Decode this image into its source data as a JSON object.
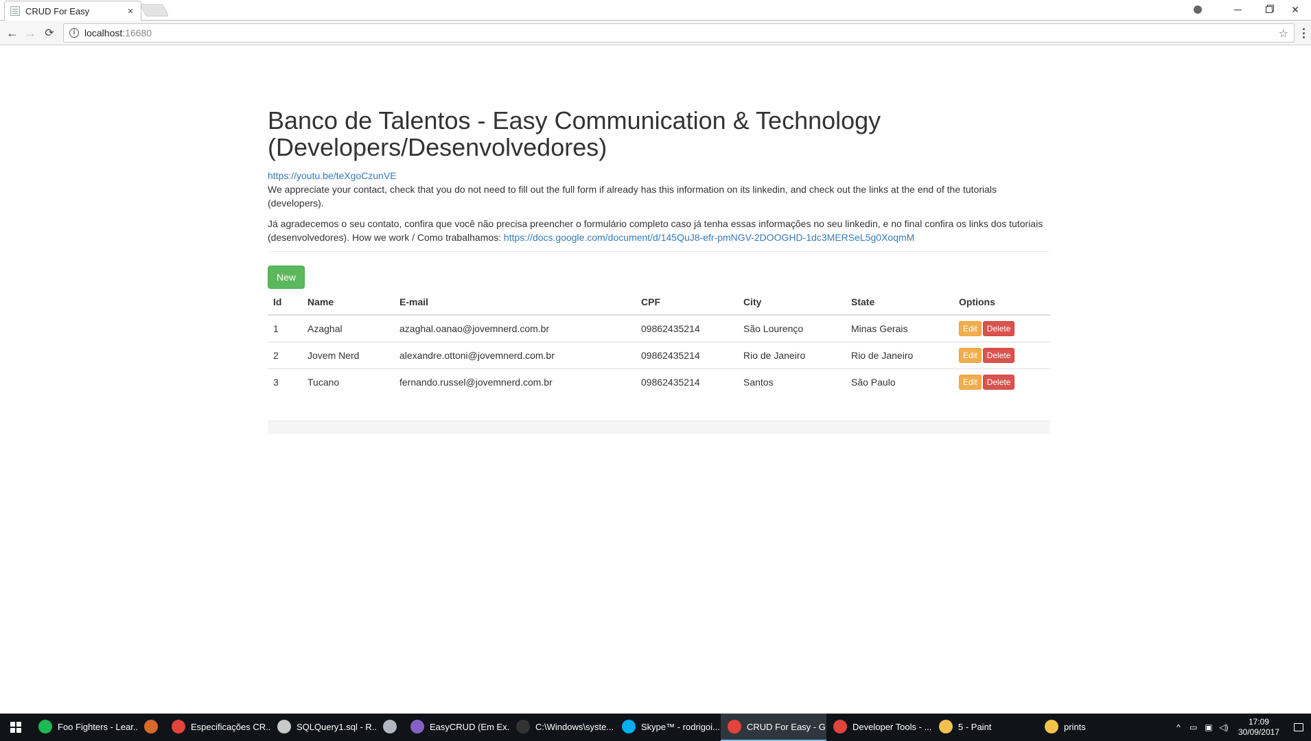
{
  "browser": {
    "tab_title": "CRUD For Easy",
    "tab_close": "×",
    "url_host": "localhost",
    "url_port": ":16680"
  },
  "page": {
    "title": "Banco de Talentos - Easy Communication & Technology (Developers/Desenvolvedores)",
    "video_link": "https://youtu.be/teXgoCzunVE",
    "intro_en": "We appreciate your contact, check that you do not need to fill out the full form if already has this information on its linkedin, and check out the links at the end of the tutorials (developers).",
    "intro_pt": "Já agradecemos o seu contato, confira que você não precisa preencher o formulário completo caso já tenha essas informações no seu linkedin, e no final confira os links dos tutoriais (desenvolvedores). How we work / Como trabalhamos:",
    "docs_link": "https://docs.google.com/document/d/145QuJ8-efr-pmNGV-2DOOGHD-1dc3MERSeL5g0XoqmM",
    "new_button": "New"
  },
  "table": {
    "headers": [
      "Id",
      "Name",
      "E-mail",
      "CPF",
      "City",
      "State",
      "Options"
    ],
    "edit_label": "Edit",
    "delete_label": "Delete",
    "rows": [
      {
        "id": "1",
        "name": "Azaghal",
        "email": "azaghal.oanao@jovemnerd.com.br",
        "cpf": "09862435214",
        "city": "São Lourenço",
        "state": "Minas Gerais"
      },
      {
        "id": "2",
        "name": "Jovem Nerd",
        "email": "alexandre.ottoni@jovemnerd.com.br",
        "cpf": "09862435214",
        "city": "Rio de Janeiro",
        "state": "Rio de Janeiro"
      },
      {
        "id": "3",
        "name": "Tucano",
        "email": "fernando.russel@jovemnerd.com.br",
        "cpf": "09862435214",
        "city": "Santos",
        "state": "São Paulo"
      }
    ]
  },
  "taskbar": {
    "items": [
      {
        "label": "Foo Fighters - Lear...",
        "icon": "spotify-icon",
        "color": "#1db954"
      },
      {
        "label": "",
        "icon": "app-icon",
        "color": "#d96a2a"
      },
      {
        "label": "Especificações CR...",
        "icon": "chrome-icon",
        "color": "#e2433a"
      },
      {
        "label": "SQLQuery1.sql - R...",
        "icon": "sql-server-icon",
        "color": "#c9c9c9"
      },
      {
        "label": "",
        "icon": "tool-icon",
        "color": "#b0b7c0"
      },
      {
        "label": "EasyCRUD (Em Ex...",
        "icon": "visual-studio-icon",
        "color": "#8661c5"
      },
      {
        "label": "C:\\Windows\\syste...",
        "icon": "cmd-icon",
        "color": "#333333"
      },
      {
        "label": "Skype™ - rodrigoi...",
        "icon": "skype-icon",
        "color": "#00aff0"
      },
      {
        "label": "CRUD For Easy - G...",
        "icon": "chrome-icon",
        "color": "#e2433a"
      },
      {
        "label": "Developer Tools - ...",
        "icon": "chrome-icon",
        "color": "#e2433a"
      },
      {
        "label": "5 - Paint",
        "icon": "paint-icon",
        "color": "#f2c04d"
      },
      {
        "label": "prints",
        "icon": "folder-icon",
        "color": "#f3c24a"
      }
    ],
    "time": "17:09",
    "date": "30/09/2017"
  }
}
